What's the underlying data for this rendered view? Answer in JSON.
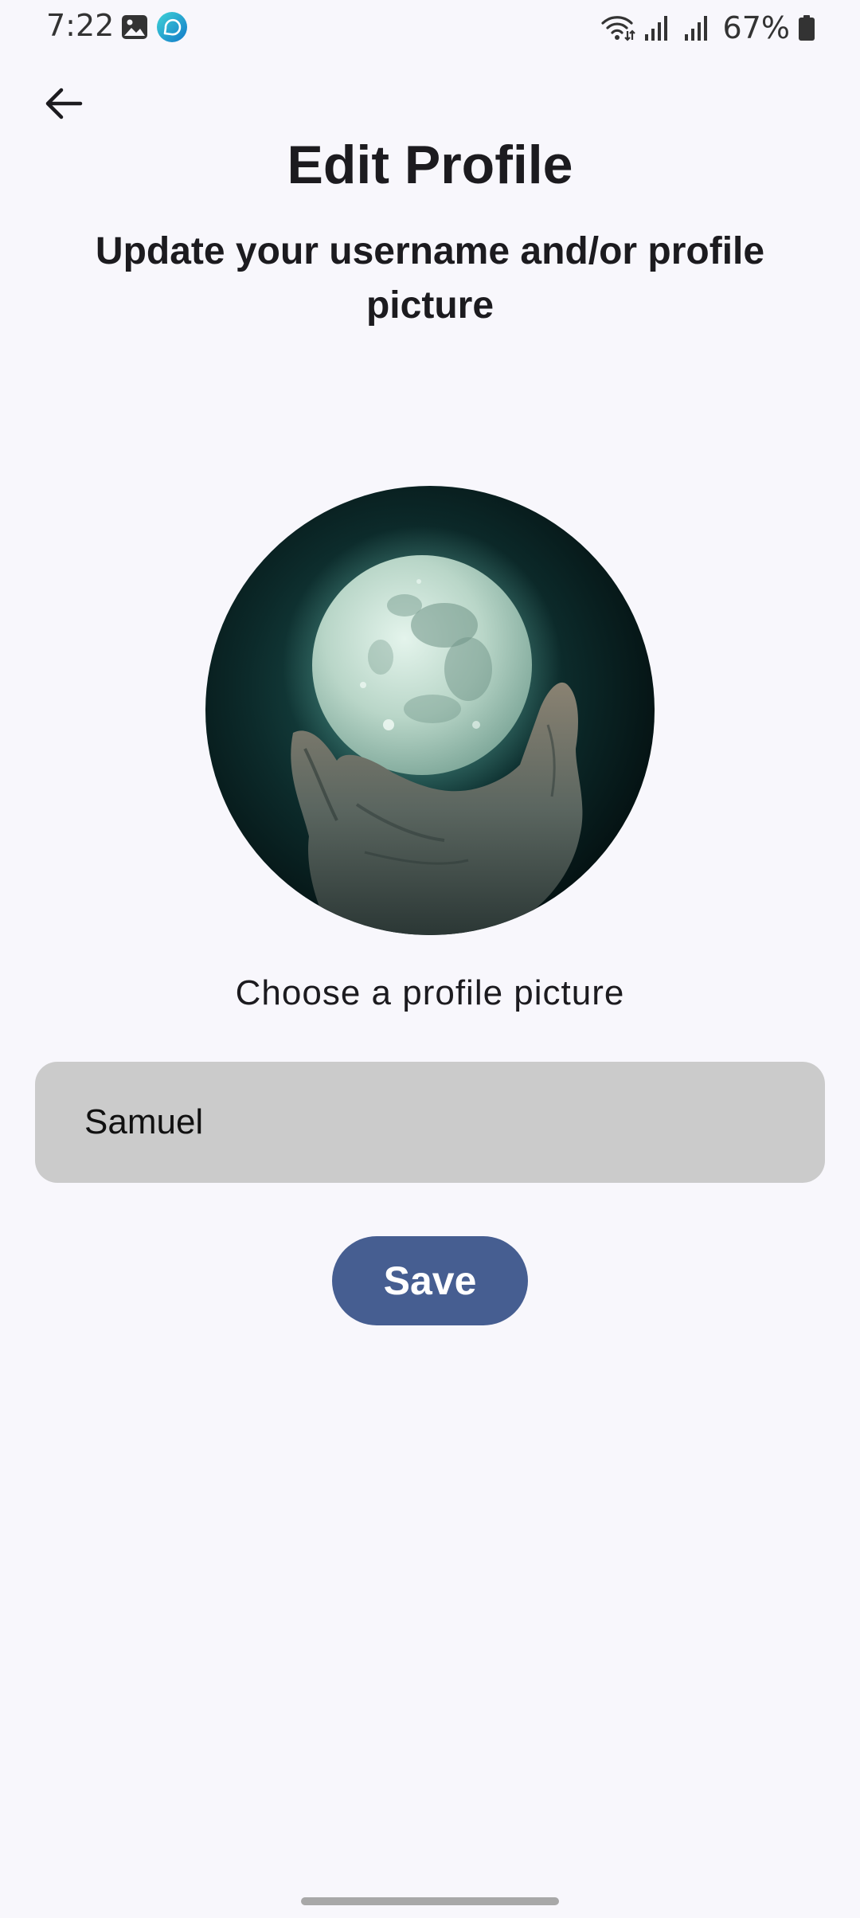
{
  "status_bar": {
    "time": "7:22",
    "battery": "67%",
    "icons": [
      "gallery-icon",
      "chat-app-icon",
      "wifi-icon",
      "signal-icon",
      "signal-icon",
      "battery-icon"
    ]
  },
  "header": {
    "back_icon": "arrow-left-icon",
    "title": "Edit Profile",
    "subtitle": "Update your username and/or profile picture"
  },
  "profile": {
    "avatar_description": "moon-in-hand-image",
    "choose_picture_label": "Choose a profile picture"
  },
  "form": {
    "username_value": "Samuel",
    "save_label": "Save"
  },
  "colors": {
    "background": "#f8f7fc",
    "input_background": "#cbcbcb",
    "primary_button": "#465e91",
    "button_text": "#ffffff"
  }
}
